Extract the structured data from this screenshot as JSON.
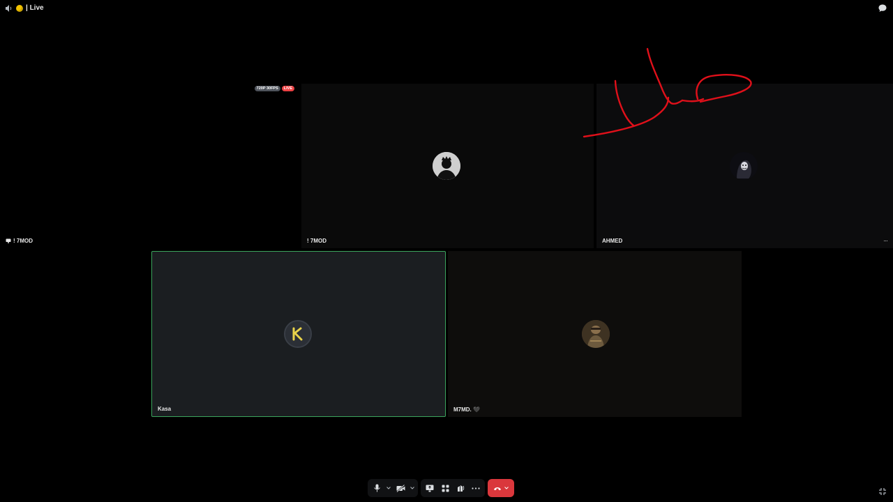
{
  "header": {
    "title": "| Live"
  },
  "stream_tile": {
    "name": "! 7MOD",
    "badge_resolution": "720P 30FPS",
    "badge_live": "LIVE"
  },
  "participants": [
    {
      "name": "! 7MOD"
    },
    {
      "name": "AHMED",
      "more_label": "···"
    },
    {
      "name": "Kasa"
    },
    {
      "name": "M7MD. 🖤"
    }
  ],
  "controls": {
    "items": [
      "microphone",
      "camera",
      "screen-share",
      "activities",
      "soundboard",
      "more",
      "disconnect"
    ]
  },
  "colors": {
    "speaking_border": "#3ba55d",
    "hangup": "#da373c",
    "live_badge": "#ed4245",
    "drawing": "#e0101a"
  }
}
